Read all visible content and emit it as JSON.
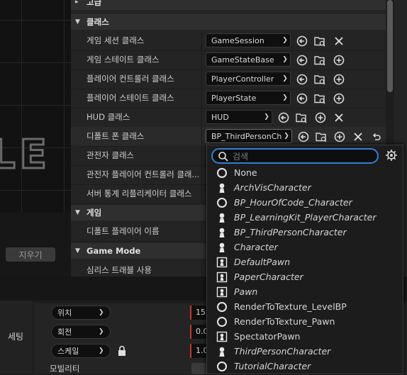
{
  "details": {
    "collapsed_top_label": "고급",
    "classes_category": "클래스",
    "game_category": "게임",
    "gamemode_category": "Game Mode",
    "rows": [
      {
        "label": "게임 세션 클래스",
        "value": "GameSession"
      },
      {
        "label": "게임 스테이트 클래스",
        "value": "GameStateBase"
      },
      {
        "label": "플레이어 컨트롤러 클래스",
        "value": "PlayerController"
      },
      {
        "label": "플레이어 스테이트 클래스",
        "value": "PlayerState"
      },
      {
        "label": "HUD 클래스",
        "value": "HUD"
      },
      {
        "label": "디폴트 폰 클래스",
        "value": "BP_ThirdPersonCharacter"
      },
      {
        "label": "관전자 클래스"
      },
      {
        "label": "관전자 플레이어 컨트롤러 클래..."
      },
      {
        "label": "서버 통계 리플리케이터 클래스"
      }
    ],
    "default_player_name_label": "디폴트 플레이어 이름",
    "streaming_label": "심리스 트래블 사용"
  },
  "viewport": {
    "clear_button": "지우기"
  },
  "transform": {
    "settings_tab": "세팅",
    "rows": [
      {
        "label": "위치",
        "value": "15"
      },
      {
        "label": "회전",
        "value": "0.0"
      },
      {
        "label": "스케일",
        "value": "1.0"
      }
    ],
    "mobility_label": "모빌리티"
  },
  "dropdown": {
    "search_placeholder": "검색",
    "items": [
      {
        "name": "None",
        "italic": false,
        "icon": "circle-icon"
      },
      {
        "name": "ArchVisCharacter",
        "italic": true,
        "icon": "pawn-icon"
      },
      {
        "name": "BP_HourOfCode_Character",
        "italic": true,
        "icon": "circle-icon"
      },
      {
        "name": "BP_LearningKit_PlayerCharacter",
        "italic": true,
        "icon": "pawn-icon"
      },
      {
        "name": "BP_ThirdPersonCharacter",
        "italic": true,
        "icon": "pawn-icon"
      },
      {
        "name": "Character",
        "italic": true,
        "icon": "pawn-icon"
      },
      {
        "name": "DefaultPawn",
        "italic": true,
        "icon": "pawn-box-icon"
      },
      {
        "name": "PaperCharacter",
        "italic": true,
        "icon": "pawn-box-icon"
      },
      {
        "name": "Pawn",
        "italic": true,
        "icon": "pawn-box-icon"
      },
      {
        "name": "RenderToTexture_LevelBP",
        "italic": false,
        "icon": "circle-icon"
      },
      {
        "name": "RenderToTexture_Pawn",
        "italic": false,
        "icon": "circle-icon"
      },
      {
        "name": "SpectatorPawn",
        "italic": false,
        "icon": "pawn-box-icon"
      },
      {
        "name": "ThirdPersonCharacter",
        "italic": true,
        "icon": "pawn-icon"
      },
      {
        "name": "TutorialCharacter",
        "italic": true,
        "icon": "circle-icon"
      }
    ]
  },
  "colors": {
    "accent": "#2f7fd6",
    "panel": "#242424",
    "category": "#2f2f2f",
    "axis_red": "#c0392b"
  }
}
